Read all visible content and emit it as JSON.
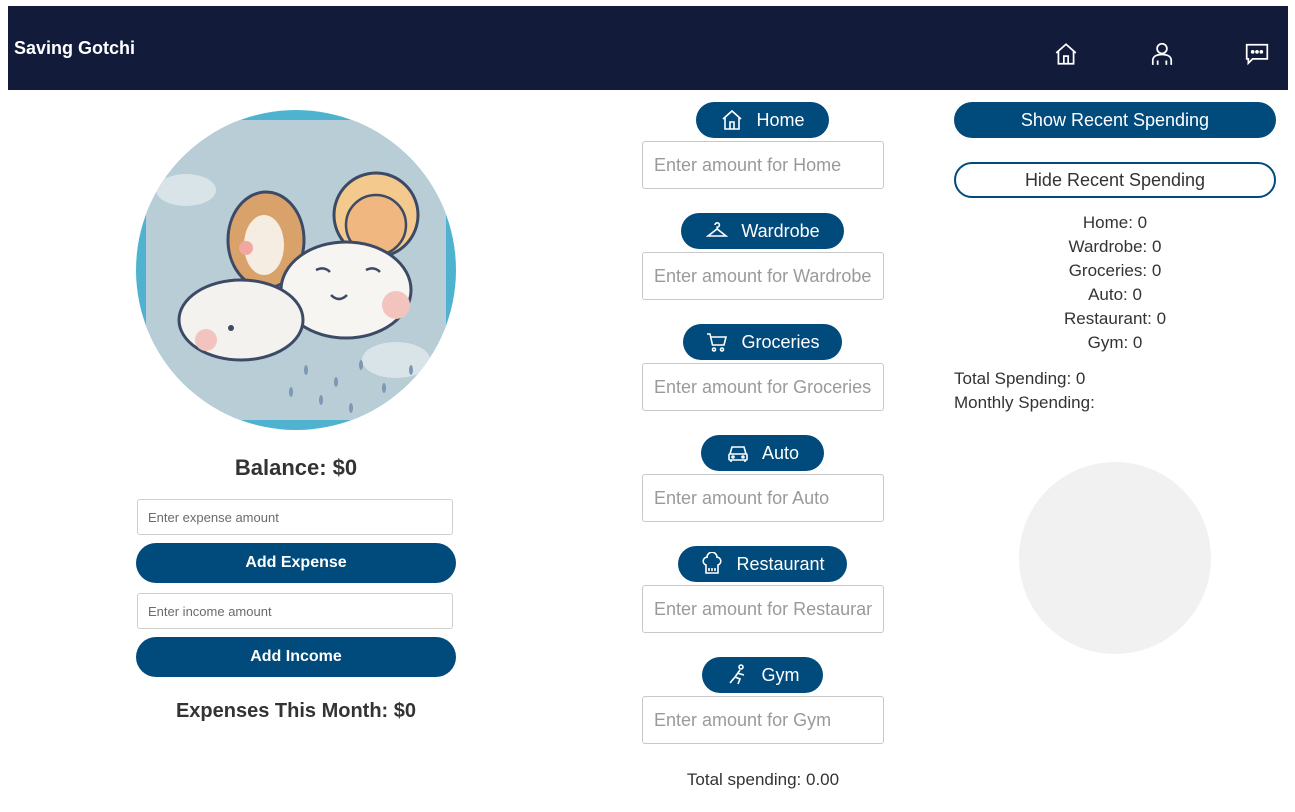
{
  "app": {
    "title": "Saving Gotchi"
  },
  "nav": {
    "icons": [
      "home-icon",
      "user-icon",
      "chat-icon"
    ]
  },
  "left": {
    "balance": "Balance: $0",
    "expense_placeholder": "Enter expense amount",
    "add_expense_label": "Add Expense",
    "income_placeholder": "Enter income amount",
    "add_income_label": "Add Income",
    "expenses_month": "Expenses This Month: $0"
  },
  "categories": [
    {
      "label": "Home",
      "placeholder": "Enter amount for Home",
      "icon": "home-icon"
    },
    {
      "label": "Wardrobe",
      "placeholder": "Enter amount for Wardrobe",
      "icon": "hanger-icon"
    },
    {
      "label": "Groceries",
      "placeholder": "Enter amount for Groceries",
      "icon": "cart-icon"
    },
    {
      "label": "Auto",
      "placeholder": "Enter amount for Auto",
      "icon": "car-icon"
    },
    {
      "label": "Restaurant",
      "placeholder": "Enter amount for Restaurant",
      "icon": "chef-hat-icon"
    },
    {
      "label": "Gym",
      "placeholder": "Enter amount for Gym",
      "icon": "exercise-icon"
    }
  ],
  "middle": {
    "total_spending": "Total spending: 0.00"
  },
  "right": {
    "show_label": "Show Recent Spending",
    "hide_label": "Hide Recent Spending",
    "recent": [
      "Home: 0",
      "Wardrobe: 0",
      "Groceries: 0",
      "Auto: 0",
      "Restaurant: 0",
      "Gym: 0"
    ],
    "total_spending": "Total Spending: 0",
    "monthly_spending": "Monthly Spending:"
  },
  "colors": {
    "navbar": "#121c3a",
    "accent": "#004a7c",
    "avatar_ring": "#4fb3cf"
  }
}
